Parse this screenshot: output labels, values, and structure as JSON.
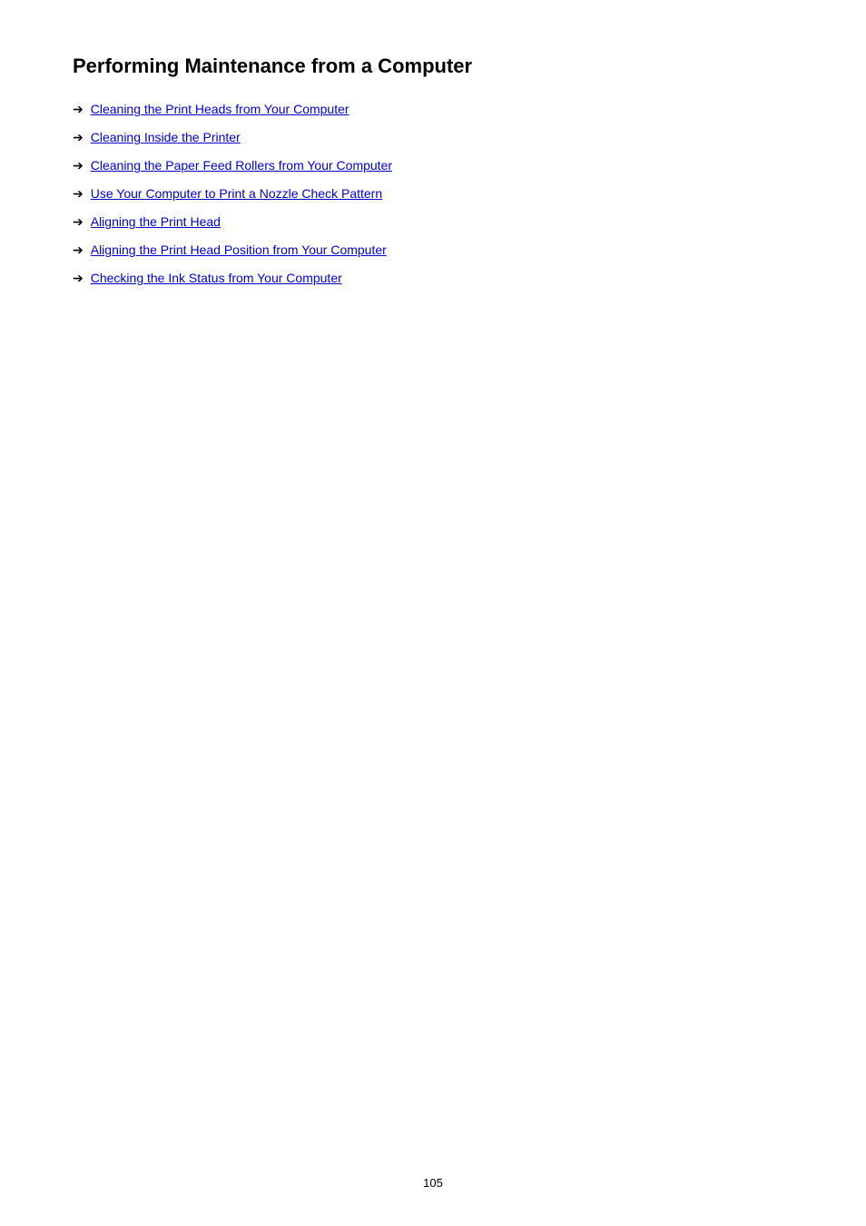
{
  "page": {
    "title": "Performing Maintenance from a Computer",
    "page_number": "105",
    "links": [
      {
        "id": "link-1",
        "label": "Cleaning the Print Heads from Your Computer"
      },
      {
        "id": "link-2",
        "label": "Cleaning Inside the Printer"
      },
      {
        "id": "link-3",
        "label": "Cleaning the Paper Feed Rollers from Your Computer"
      },
      {
        "id": "link-4",
        "label": "Use Your Computer to Print a Nozzle Check Pattern"
      },
      {
        "id": "link-5",
        "label": "Aligning the Print Head"
      },
      {
        "id": "link-6",
        "label": "Aligning the Print Head Position from Your Computer"
      },
      {
        "id": "link-7",
        "label": "Checking the Ink Status from Your Computer"
      }
    ],
    "arrow_symbol": "➔"
  }
}
